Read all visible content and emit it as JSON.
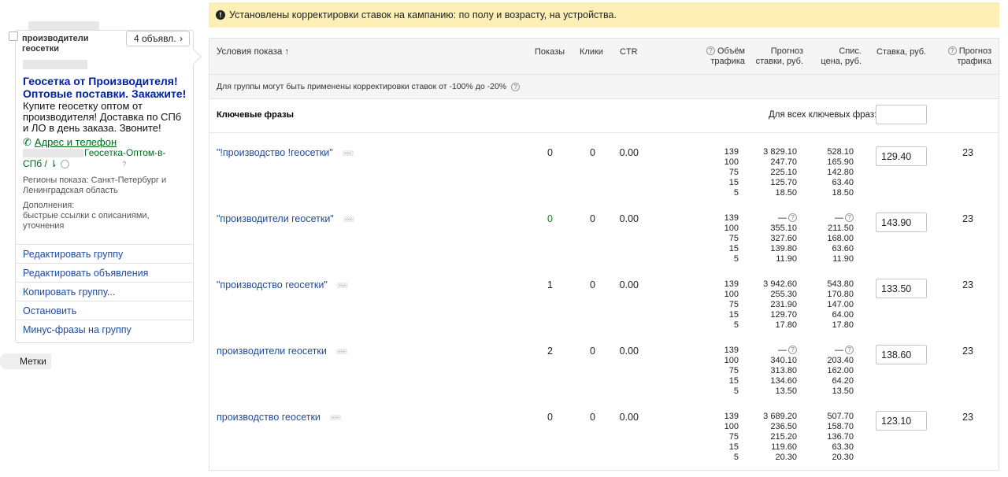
{
  "banner": {
    "text": "Установлены корректировки ставок на кампанию: по полу и возрасту, на устройства."
  },
  "group": {
    "name": "производители геосетки",
    "ads_count": "4 объявл.",
    "ad_title": "Геосетка от Производителя! Оптовые поставки. Закажите!",
    "ad_text": "Купите геосетку оптом от производителя! Доставка по СПб и ЛО в день заказа. Звоните!",
    "address_link": "Адрес и телефон",
    "display_url": "Геосетка-Оптом-в-СПб / ",
    "regions_label": "Регионы показа: Санкт-Петербург и Ленинградская область",
    "extras_label": "Дополнения:",
    "extras_value": "быстрые ссылки с описаниями, уточнения",
    "actions": [
      "Редактировать группу",
      "Редактировать объявления",
      "Копировать группу...",
      "Остановить",
      "Минус-фразы на группу"
    ],
    "tags_button": "Метки"
  },
  "table": {
    "headers": {
      "conditions": "Условия показа ↑",
      "impressions": "Показы",
      "clicks": "Клики",
      "ctr": "CTR",
      "traffic_volume_1": "Объём",
      "traffic_volume_2": "трафика",
      "forecast_bid_1": "Прогноз",
      "forecast_bid_2": "ставки, руб.",
      "charged_price_1": "Спис.",
      "charged_price_2": "цена, руб.",
      "bid": "Ставка, руб.",
      "traffic_forecast_1": "Прогноз",
      "traffic_forecast_2": "трафика"
    },
    "note": "Для группы могут быть применены корректировки ставок от -100% до -20%",
    "keywords_title": "Ключевые фразы",
    "for_all_label": "Для всех ключевых фраз:",
    "for_all_value": "",
    "rows": [
      {
        "phrase": "\"!производство !геосетки\"",
        "impressions": "0",
        "clicks": "0",
        "ctr": "0.00",
        "volumes": [
          "139",
          "100",
          "75",
          "15",
          "5"
        ],
        "forecast": [
          "3 829.10",
          "247.70",
          "225.10",
          "125.70",
          "18.50"
        ],
        "price": [
          "528.10",
          "165.90",
          "142.80",
          "63.40",
          "18.50"
        ],
        "bid": "129.40",
        "traffic": "23"
      },
      {
        "phrase": "\"производители геосетки\"",
        "impressions": "0",
        "clicks": "0",
        "ctr": "0.00",
        "volumes": [
          "139",
          "100",
          "75",
          "15",
          "5"
        ],
        "forecast": [
          "—",
          "355.10",
          "327.60",
          "139.80",
          "11.90"
        ],
        "price": [
          "—",
          "211.50",
          "168.00",
          "63.60",
          "11.90"
        ],
        "bid": "143.90",
        "traffic": "23"
      },
      {
        "phrase": "\"производство геосетки\"",
        "impressions": "1",
        "clicks": "0",
        "ctr": "0.00",
        "volumes": [
          "139",
          "100",
          "75",
          "15",
          "5"
        ],
        "forecast": [
          "3 942.60",
          "255.30",
          "231.90",
          "129.70",
          "17.80"
        ],
        "price": [
          "543.80",
          "170.80",
          "147.00",
          "64.00",
          "17.80"
        ],
        "bid": "133.50",
        "traffic": "23"
      },
      {
        "phrase": "производители геосетки",
        "impressions": "2",
        "clicks": "0",
        "ctr": "0.00",
        "volumes": [
          "139",
          "100",
          "75",
          "15",
          "5"
        ],
        "forecast": [
          "—",
          "340.10",
          "313.80",
          "134.60",
          "13.50"
        ],
        "price": [
          "—",
          "203.40",
          "162.00",
          "64.20",
          "13.50"
        ],
        "bid": "138.60",
        "traffic": "23"
      },
      {
        "phrase": "производство геосетки",
        "impressions": "0",
        "clicks": "0",
        "ctr": "0.00",
        "volumes": [
          "139",
          "100",
          "75",
          "15",
          "5"
        ],
        "forecast": [
          "3 689.20",
          "236.50",
          "215.20",
          "119.60",
          "20.30"
        ],
        "price": [
          "507.70",
          "158.70",
          "136.70",
          "63.30",
          "20.30"
        ],
        "bid": "123.10",
        "traffic": "23"
      }
    ]
  }
}
